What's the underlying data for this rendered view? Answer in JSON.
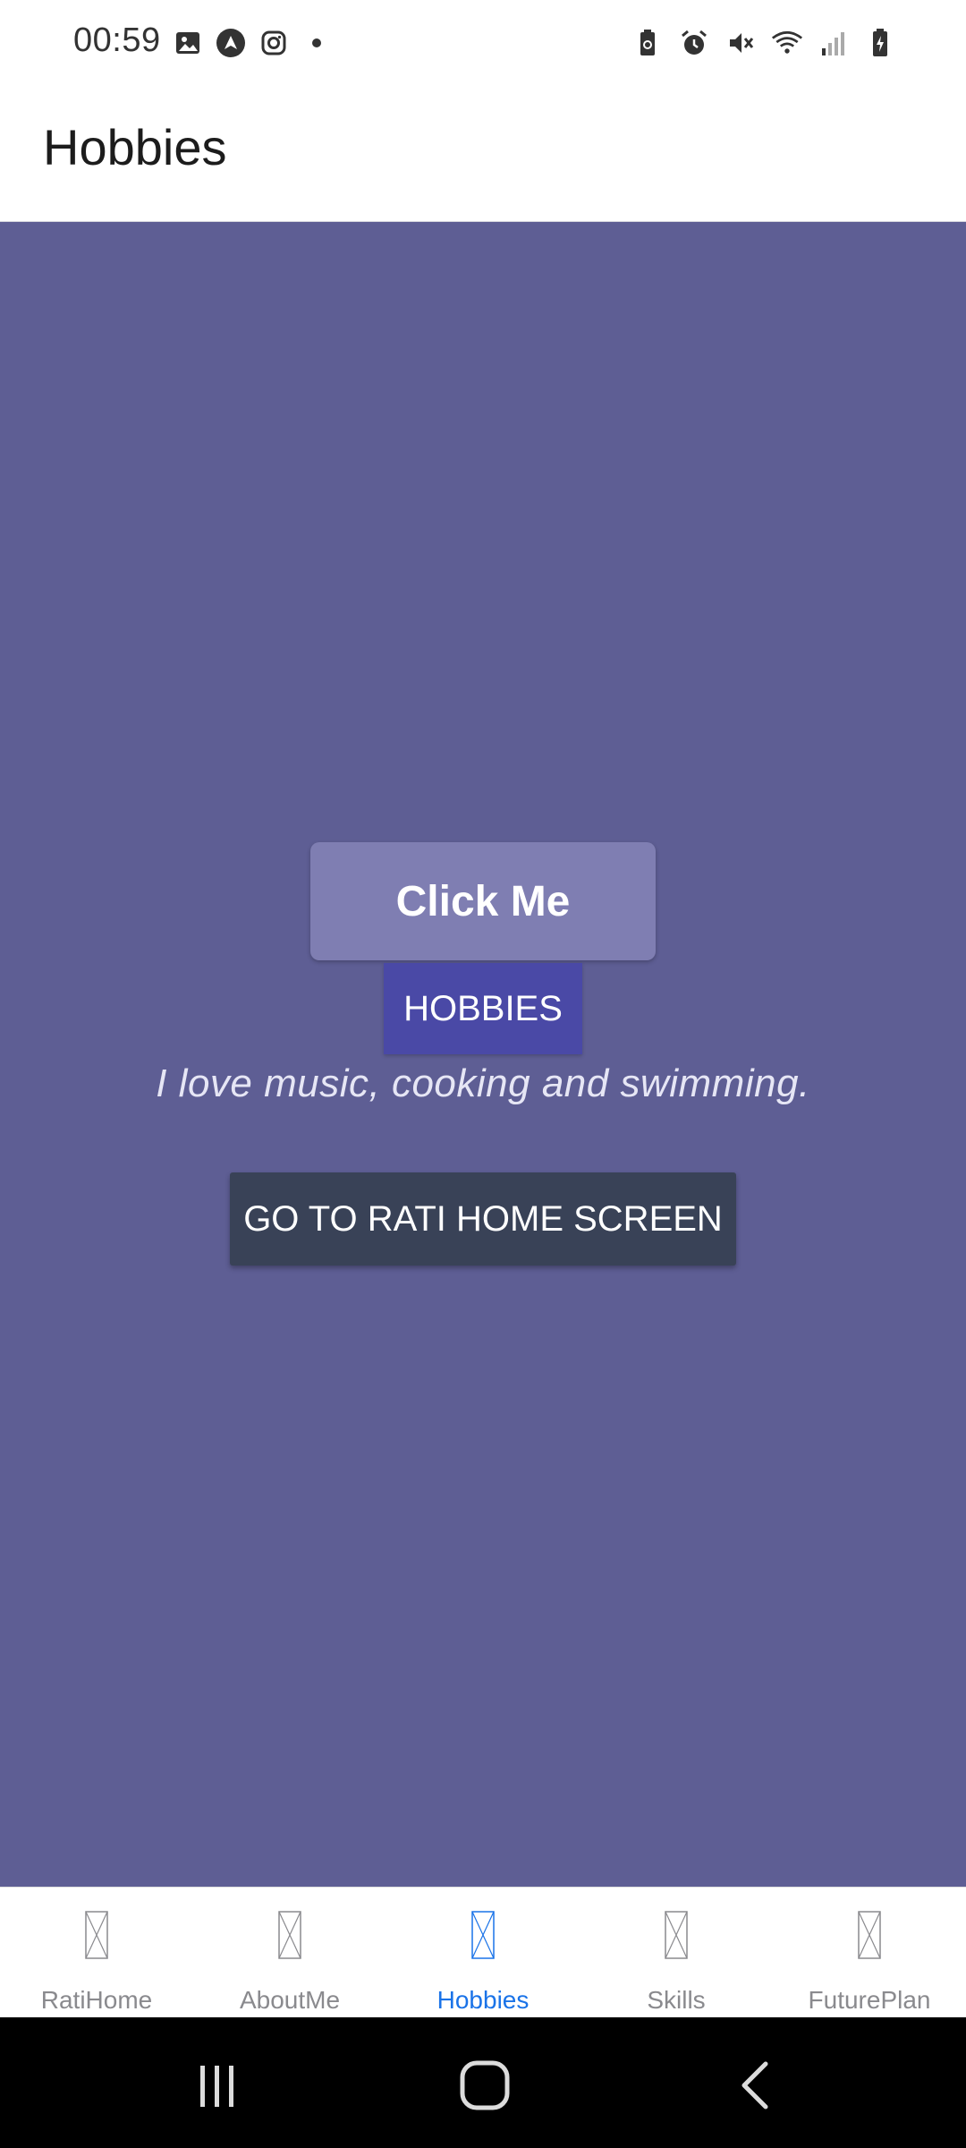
{
  "status_bar": {
    "time": "00:59",
    "left_icons": [
      "gallery-icon",
      "nav-app-icon",
      "instagram-icon",
      "dot-icon"
    ],
    "right_icons": [
      "battery-saver-icon",
      "alarm-icon",
      "mute-icon",
      "wifi-icon",
      "signal-icon",
      "battery-icon"
    ]
  },
  "header": {
    "title": "Hobbies"
  },
  "main": {
    "background_color": "#5e5e94",
    "click_button_label": "Click Me",
    "section_badge": "HOBBIES",
    "description": "I love music, cooking and swimming.",
    "go_home_button_label": "GO TO RATI HOME SCREEN"
  },
  "tabs": [
    {
      "label": "RatiHome",
      "icon": "missing-glyph-icon",
      "active": false
    },
    {
      "label": "AboutMe",
      "icon": "missing-glyph-icon",
      "active": false
    },
    {
      "label": "Hobbies",
      "icon": "missing-glyph-icon",
      "active": true
    },
    {
      "label": "Skills",
      "icon": "missing-glyph-icon",
      "active": false
    },
    {
      "label": "FuturePlan",
      "icon": "missing-glyph-icon",
      "active": false
    }
  ],
  "nav_bar": {
    "buttons": [
      "recents-icon",
      "home-icon",
      "back-icon"
    ]
  },
  "colors": {
    "accent": "#1a73e8",
    "badge": "#4a49a6",
    "home_button": "#394257",
    "click_button": "#7f7eb2"
  }
}
